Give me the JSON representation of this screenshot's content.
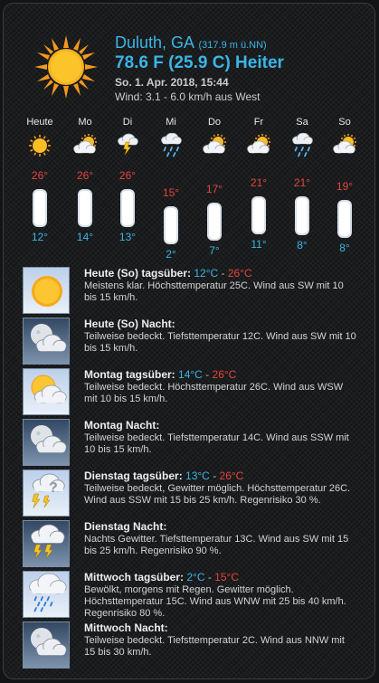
{
  "header": {
    "city": "Duluth, GA",
    "elevation": "(317.9 m ü.NN)",
    "current": "78.6 F (25.9 C) Heiter",
    "datetime": "So. 1. Apr. 2018, 15:44",
    "wind": "Wind: 3.1 - 6.0 km/h aus West",
    "icon": "sun-icon"
  },
  "forecast": [
    {
      "day": "Heute",
      "icon": "sun-icon",
      "max": "26°",
      "min": "12°",
      "max_c": 26,
      "min_c": 12
    },
    {
      "day": "Mo",
      "icon": "partly-cloudy-icon",
      "max": "26°",
      "min": "14°",
      "max_c": 26,
      "min_c": 14
    },
    {
      "day": "Di",
      "icon": "thunderstorm-icon",
      "max": "26°",
      "min": "13°",
      "max_c": 26,
      "min_c": 13
    },
    {
      "day": "Mi",
      "icon": "rain-icon",
      "max": "15°",
      "min": "2°",
      "max_c": 15,
      "min_c": 2
    },
    {
      "day": "Do",
      "icon": "partly-cloudy-icon",
      "max": "17°",
      "min": "7°",
      "max_c": 17,
      "min_c": 7
    },
    {
      "day": "Fr",
      "icon": "partly-cloudy-icon",
      "max": "21°",
      "min": "11°",
      "max_c": 21,
      "min_c": 11
    },
    {
      "day": "Sa",
      "icon": "rain-icon",
      "max": "21°",
      "min": "8°",
      "max_c": 21,
      "min_c": 8
    },
    {
      "day": "So",
      "icon": "partly-cloudy-icon",
      "max": "19°",
      "min": "8°",
      "max_c": 19,
      "min_c": 8
    }
  ],
  "periods": [
    {
      "title": "Heute (So) tagsüber:",
      "lo": "12°C",
      "sep": "-",
      "hi": "26°C",
      "desc": "Meistens klar. Höchsttemperatur 25C. Wind aus SW mit 10 bis 15 km/h.",
      "icon": "clear-day-icon",
      "kind": "day"
    },
    {
      "title": "Heute (So) Nacht:",
      "lo": "",
      "sep": "",
      "hi": "",
      "desc": "Teilweise bedeckt. Tiefsttemperatur 12C. Wind aus SW mit 10 bis 15 km/h.",
      "icon": "partly-cloudy-night-icon",
      "kind": "night"
    },
    {
      "title": "Montag tagsüber:",
      "lo": "14°C",
      "sep": "-",
      "hi": "26°C",
      "desc": "Teilweise bedeckt. Höchsttemperatur 26C. Wind aus WSW mit 10 bis 15 km/h.",
      "icon": "partly-cloudy-day-icon",
      "kind": "day"
    },
    {
      "title": "Montag Nacht:",
      "lo": "",
      "sep": "",
      "hi": "",
      "desc": "Teilweise bedeckt. Tiefsttemperatur 14C. Wind aus SSW mit 10 bis 15 km/h.",
      "icon": "partly-cloudy-night-icon",
      "kind": "night"
    },
    {
      "title": "Dienstag tagsüber:",
      "lo": "13°C",
      "sep": "-",
      "hi": "26°C",
      "desc": "Teilweise bedeckt, Gewitter möglich. Höchsttemperatur 26C. Wind aus SSW mit 15 bis 25 km/h. Regenrisiko 30 %.",
      "icon": "possible-thunderstorm-icon",
      "kind": "day"
    },
    {
      "title": "Dienstag Nacht:",
      "lo": "",
      "sep": "",
      "hi": "",
      "desc": "Nachts Gewitter. Tiefsttemperatur 13C. Wind aus SW mit 15 bis 25 km/h. Regenrisiko 90 %.",
      "icon": "thunderstorm-night-icon",
      "kind": "night"
    },
    {
      "title": "Mittwoch tagsüber:",
      "lo": "2°C",
      "sep": "-",
      "hi": "15°C",
      "desc": "Bewölkt, morgens mit Regen. Gewitter möglich. Höchsttemperatur 15C. Wind aus WNW mit 25 bis 40 km/h. Regenrisiko 80 %.",
      "icon": "rain-day-icon",
      "kind": "day"
    },
    {
      "title": "Mittwoch Nacht:",
      "lo": "",
      "sep": "",
      "hi": "",
      "desc": "Teilweise bedeckt. Tiefsttemperatur 2C. Wind aus NNW mit 15 bis 30 km/h.",
      "icon": "partly-cloudy-night-icon",
      "kind": "night"
    }
  ],
  "colors": {
    "accent": "#3ab6e6",
    "high": "#e2463e",
    "text": "#d2d4d6"
  }
}
